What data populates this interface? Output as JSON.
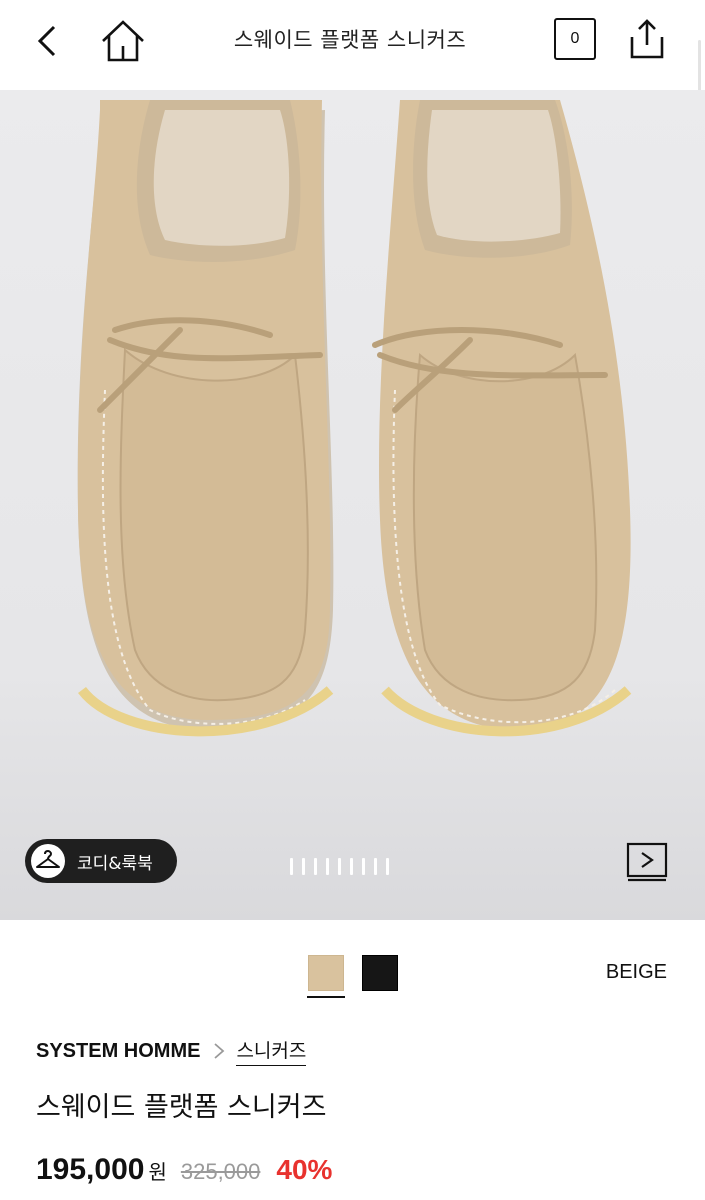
{
  "header": {
    "title": "스웨이드 플랫폼 스니커즈",
    "cart_count": "0",
    "icons": [
      "back-arrow-icon",
      "home-icon",
      "share-icon"
    ]
  },
  "hero": {
    "codi_label": "코디&룩북",
    "image_count": 9,
    "current_image": 1,
    "icons": [
      "hanger-icon",
      "video-play-icon"
    ]
  },
  "options": {
    "selected_color": "BEIGE",
    "swatch_colors": [
      "#d9c29e",
      "#161616"
    ],
    "selected_swatch_index": 0
  },
  "product": {
    "brand": "SYSTEM HOMME",
    "category": "스니커즈",
    "name": "스웨이드 플랫폼 스니커즈",
    "price": "195,000",
    "currency": "원",
    "original_price": "325,000",
    "discount": "40%"
  },
  "colors": {
    "discount_red": "#e8322e",
    "suede": "#d8c19d"
  }
}
